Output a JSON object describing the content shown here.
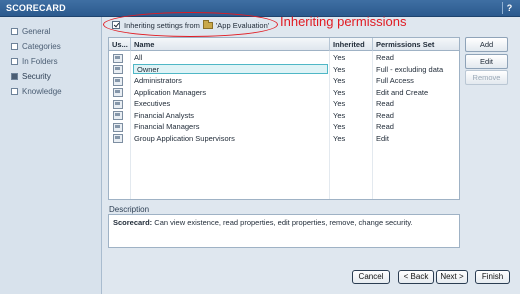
{
  "window": {
    "title": "SCORECARD",
    "help_label": "?"
  },
  "sidebar": {
    "items": [
      {
        "label": "General",
        "active": false
      },
      {
        "label": "Categories",
        "active": false
      },
      {
        "label": "In Folders",
        "active": false
      },
      {
        "label": "Security",
        "active": true
      },
      {
        "label": "Knowledge",
        "active": false
      }
    ]
  },
  "inherit": {
    "checked": true,
    "prefix": "Inheriting settings from",
    "folder_icon": "folder-icon",
    "folder_name": "'App Evaluation'"
  },
  "annotation": {
    "text": "Inheriting permissions",
    "color": "#e11b22"
  },
  "grid": {
    "columns": [
      "Us...",
      "Name",
      "Inherited",
      "Permissions Set"
    ],
    "rows": [
      {
        "icon": "user-group-icon",
        "name": "All",
        "inherited": "Yes",
        "permission": "Read",
        "selected": false
      },
      {
        "icon": "user-group-icon",
        "name": "Owner",
        "inherited": "Yes",
        "permission": "Full - excluding data",
        "selected": true
      },
      {
        "icon": "user-group-icon",
        "name": "Administrators",
        "inherited": "Yes",
        "permission": "Full Access",
        "selected": false
      },
      {
        "icon": "user-group-icon",
        "name": "Application Managers",
        "inherited": "Yes",
        "permission": "Edit and Create",
        "selected": false
      },
      {
        "icon": "user-group-icon",
        "name": "Executives",
        "inherited": "Yes",
        "permission": "Read",
        "selected": false
      },
      {
        "icon": "user-group-icon",
        "name": "Financial Analysts",
        "inherited": "Yes",
        "permission": "Read",
        "selected": false
      },
      {
        "icon": "user-group-icon",
        "name": "Financial Managers",
        "inherited": "Yes",
        "permission": "Read",
        "selected": false
      },
      {
        "icon": "user-group-icon",
        "name": "Group Application Supervisors",
        "inherited": "Yes",
        "permission": "Edit",
        "selected": false
      }
    ]
  },
  "side_buttons": {
    "add": "Add",
    "edit": "Edit",
    "remove": "Remove"
  },
  "description": {
    "label": "Description",
    "subject": "Scorecard:",
    "text": " Can view existence, read properties, edit properties, remove, change security."
  },
  "footer": {
    "cancel": "Cancel",
    "back": "< Back",
    "next": "Next >",
    "finish": "Finish"
  }
}
